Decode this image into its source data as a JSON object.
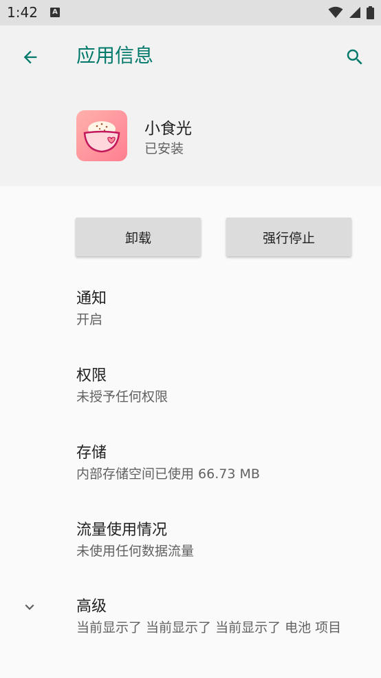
{
  "status_bar": {
    "time": "1:42",
    "notification_icon_letter": "A",
    "icons": [
      "wifi-icon",
      "signal-icon",
      "battery-icon"
    ]
  },
  "header": {
    "title": "应用信息",
    "back_icon": "arrow-back-icon",
    "search_icon": "search-icon",
    "accent_color": "#00796b"
  },
  "app": {
    "name": "小食光",
    "status": "已安装",
    "icon": "rice-bowl-heart-icon"
  },
  "buttons": {
    "uninstall": "卸载",
    "force_stop": "强行停止"
  },
  "items": [
    {
      "title": "通知",
      "subtitle": "开启"
    },
    {
      "title": "权限",
      "subtitle": "未授予任何权限"
    },
    {
      "title": "存储",
      "subtitle": "内部存储空间已使用 66.73 MB"
    },
    {
      "title": "流量使用情况",
      "subtitle": "未使用任何数据流量"
    },
    {
      "title": "高级",
      "subtitle": "当前显示了 当前显示了 当前显示了 电池 项目"
    }
  ]
}
